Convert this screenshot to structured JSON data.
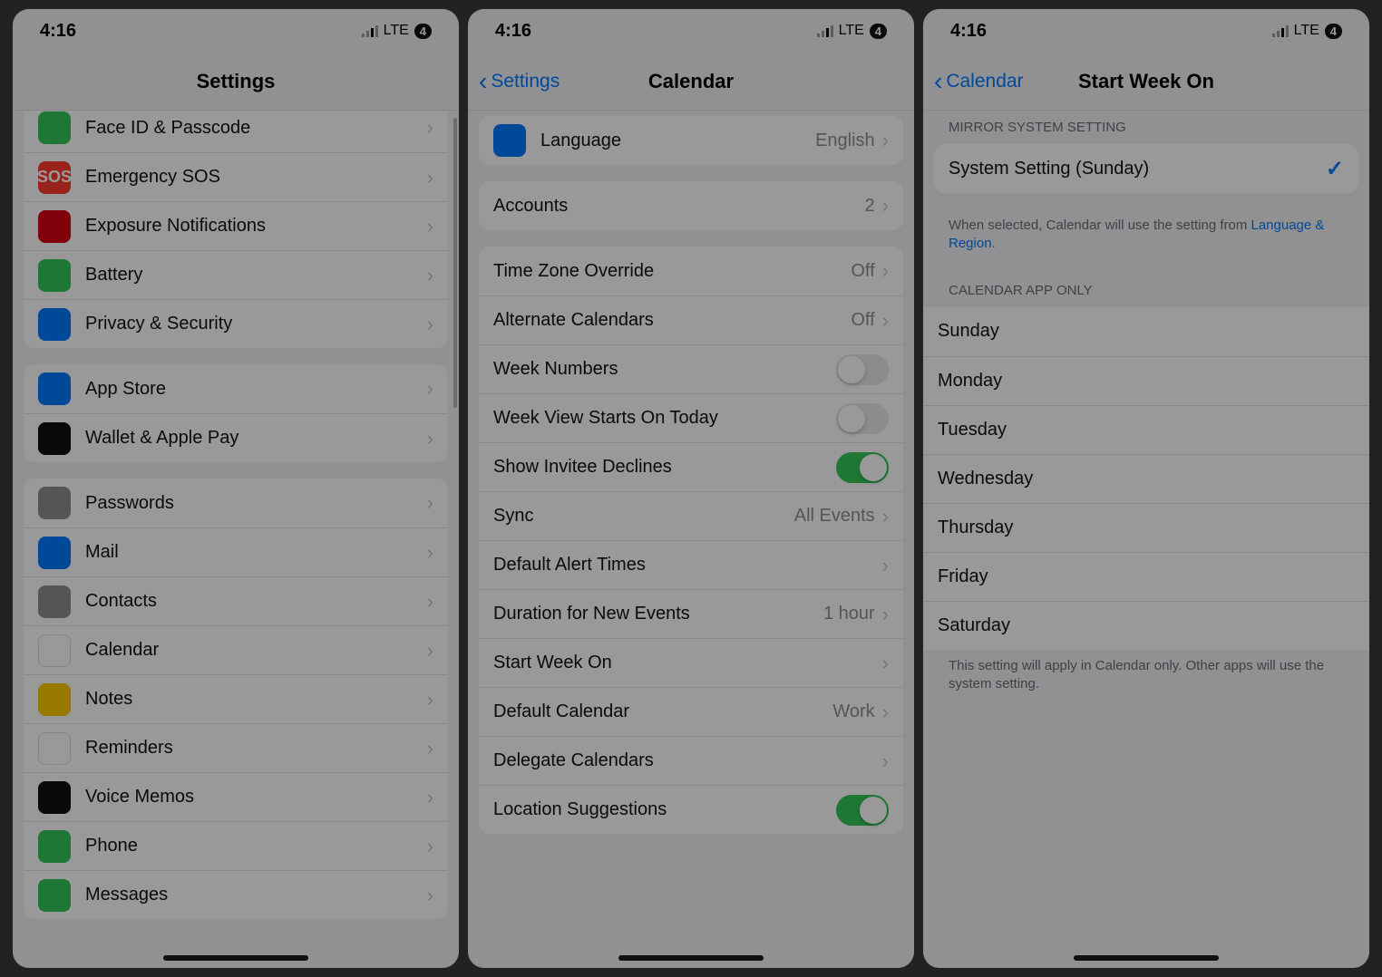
{
  "status": {
    "time": "4:16",
    "carrier_label": "LTE",
    "battery_label": "4"
  },
  "panel1": {
    "title": "Settings",
    "groups": [
      {
        "items": [
          {
            "label": "Face ID & Passcode",
            "icon_name": "face-id-icon",
            "icon_class": "ic-green"
          },
          {
            "label": "Emergency SOS",
            "icon_name": "sos-icon",
            "icon_class": "ic-red",
            "icon_text": "SOS"
          },
          {
            "label": "Exposure Notifications",
            "icon_name": "exposure-icon",
            "icon_class": "ic-darkred"
          },
          {
            "label": "Battery",
            "icon_name": "battery-icon",
            "icon_class": "ic-green"
          },
          {
            "label": "Privacy & Security",
            "icon_name": "privacy-icon",
            "icon_class": "ic-blue"
          }
        ]
      },
      {
        "items": [
          {
            "label": "App Store",
            "icon_name": "appstore-icon",
            "icon_class": "ic-blue"
          },
          {
            "label": "Wallet & Apple Pay",
            "icon_name": "wallet-icon",
            "icon_class": "ic-black"
          }
        ]
      },
      {
        "items": [
          {
            "label": "Passwords",
            "icon_name": "passwords-icon",
            "icon_class": "ic-gray"
          },
          {
            "label": "Mail",
            "icon_name": "mail-icon",
            "icon_class": "ic-blue"
          },
          {
            "label": "Contacts",
            "icon_name": "contacts-icon",
            "icon_class": "ic-gray"
          },
          {
            "label": "Calendar",
            "icon_name": "calendar-icon",
            "icon_class": "ic-white",
            "highlight": true
          },
          {
            "label": "Notes",
            "icon_name": "notes-icon",
            "icon_class": "ic-yellow"
          },
          {
            "label": "Reminders",
            "icon_name": "reminders-icon",
            "icon_class": "ic-white"
          },
          {
            "label": "Voice Memos",
            "icon_name": "voicememos-icon",
            "icon_class": "ic-black"
          },
          {
            "label": "Phone",
            "icon_name": "phone-icon",
            "icon_class": "ic-green"
          },
          {
            "label": "Messages",
            "icon_name": "messages-icon",
            "icon_class": "ic-green"
          }
        ]
      }
    ]
  },
  "panel2": {
    "back_label": "Settings",
    "title": "Calendar",
    "groups": [
      {
        "items": [
          {
            "label": "Language",
            "value": "English",
            "icon_name": "language-icon",
            "icon_class": "ic-blue",
            "chevron": true
          }
        ]
      },
      {
        "items": [
          {
            "label": "Accounts",
            "value": "2",
            "chevron": true
          }
        ]
      },
      {
        "items": [
          {
            "label": "Time Zone Override",
            "value": "Off",
            "chevron": true
          },
          {
            "label": "Alternate Calendars",
            "value": "Off",
            "chevron": true
          },
          {
            "label": "Week Numbers",
            "toggle": false
          },
          {
            "label": "Week View Starts On Today",
            "toggle": false
          },
          {
            "label": "Show Invitee Declines",
            "toggle": true
          },
          {
            "label": "Sync",
            "value": "All Events",
            "chevron": true
          },
          {
            "label": "Default Alert Times",
            "chevron": true
          },
          {
            "label": "Duration for New Events",
            "value": "1 hour",
            "chevron": true
          },
          {
            "label": "Start Week On",
            "chevron": true,
            "highlight": true
          },
          {
            "label": "Default Calendar",
            "value": "Work",
            "chevron": true
          },
          {
            "label": "Delegate Calendars",
            "chevron": true
          },
          {
            "label": "Location Suggestions",
            "toggle": true
          }
        ]
      }
    ]
  },
  "panel3": {
    "back_label": "Calendar",
    "title": "Start Week On",
    "section1_header": "MIRROR SYSTEM SETTING",
    "system_setting_label": "System Setting (Sunday)",
    "footer1_text": "When selected, Calendar will use the setting from ",
    "footer1_link": "Language & Region",
    "footer1_suffix": ".",
    "section2_header": "CALENDAR APP ONLY",
    "days": [
      "Sunday",
      "Monday",
      "Tuesday",
      "Wednesday",
      "Thursday",
      "Friday",
      "Saturday"
    ],
    "footer2": "This setting will apply in Calendar only. Other apps will use the system setting."
  }
}
